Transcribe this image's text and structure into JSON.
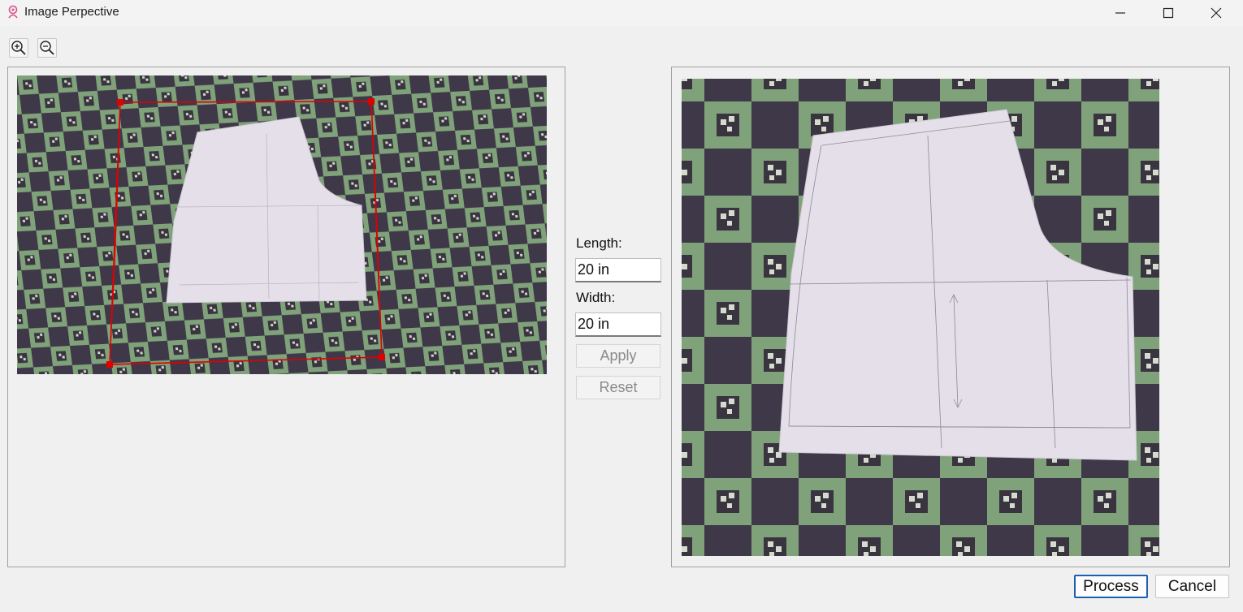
{
  "window": {
    "title": "Image Perpective"
  },
  "toolbar": {
    "zoom_in": "zoom-in-icon",
    "zoom_out": "zoom-out-icon"
  },
  "controls": {
    "length_label": "Length:",
    "length_value": "20 in",
    "width_label": "Width:",
    "width_value": "20 in",
    "apply_label": "Apply",
    "reset_label": "Reset"
  },
  "footer": {
    "process_label": "Process",
    "cancel_label": "Cancel"
  },
  "colors": {
    "board_dark": "#3f3848",
    "board_green": "#7fa27a",
    "paper": "#e4dfe9",
    "selection": "#e00000"
  }
}
